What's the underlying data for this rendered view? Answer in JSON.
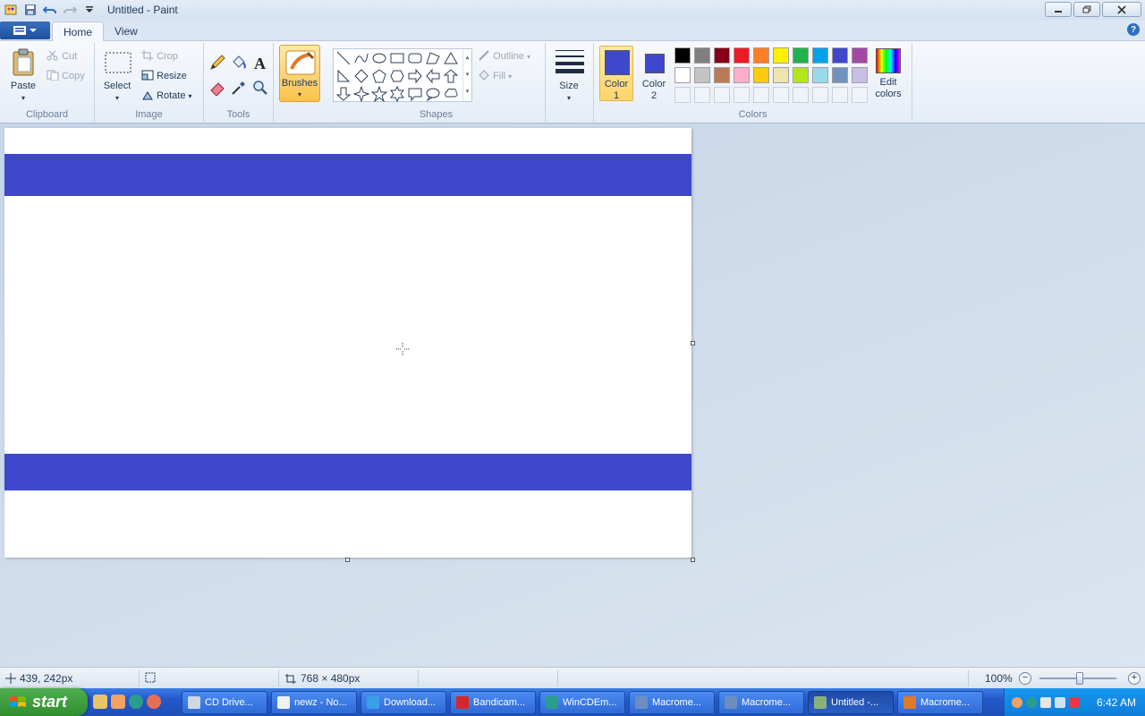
{
  "window": {
    "title": "Untitled - Paint"
  },
  "tabs": [
    {
      "label": "Home"
    },
    {
      "label": "View"
    }
  ],
  "ribbon": {
    "clipboard": {
      "label": "Clipboard",
      "paste": "Paste",
      "cut": "Cut",
      "copy": "Copy"
    },
    "image": {
      "label": "Image",
      "select": "Select",
      "crop": "Crop",
      "resize": "Resize",
      "rotate": "Rotate"
    },
    "tools": {
      "label": "Tools"
    },
    "brushes": {
      "label": "Brushes"
    },
    "shapes": {
      "label": "Shapes",
      "outline": "Outline",
      "fill": "Fill"
    },
    "size": {
      "label": "Size"
    },
    "colors": {
      "label": "Colors",
      "color1_a": "Color",
      "color1_b": "1",
      "color2_a": "Color",
      "color2_b": "2",
      "edit_a": "Edit",
      "edit_b": "colors",
      "color1_value": "#3f48cc",
      "color2_value": "#3f48cc",
      "palette_row1": [
        "#000000",
        "#7f7f7f",
        "#880015",
        "#ed1c24",
        "#ff7f27",
        "#fff200",
        "#22b14c",
        "#00a2e8",
        "#3f48cc",
        "#a349a4"
      ],
      "palette_row2": [
        "#ffffff",
        "#c3c3c3",
        "#b97a57",
        "#ffaec9",
        "#ffc90e",
        "#efe4b0",
        "#b5e61d",
        "#99d9ea",
        "#7092be",
        "#c8bfe7"
      ]
    }
  },
  "canvas": {
    "stripe_color": "#3f48cc"
  },
  "status": {
    "cursor_pos": "439, 242px",
    "canvas_size": "768 × 480px",
    "zoom": "100%"
  },
  "taskbar": {
    "start": "start",
    "tasks": [
      {
        "label": "CD Drive..."
      },
      {
        "label": "newz - No..."
      },
      {
        "label": "Download..."
      },
      {
        "label": "Bandicam..."
      },
      {
        "label": "WinCDEm..."
      },
      {
        "label": "Macrome..."
      },
      {
        "label": "Macrome..."
      },
      {
        "label": "Untitled -..."
      },
      {
        "label": "Macrome..."
      }
    ],
    "clock": "6:42 AM"
  }
}
